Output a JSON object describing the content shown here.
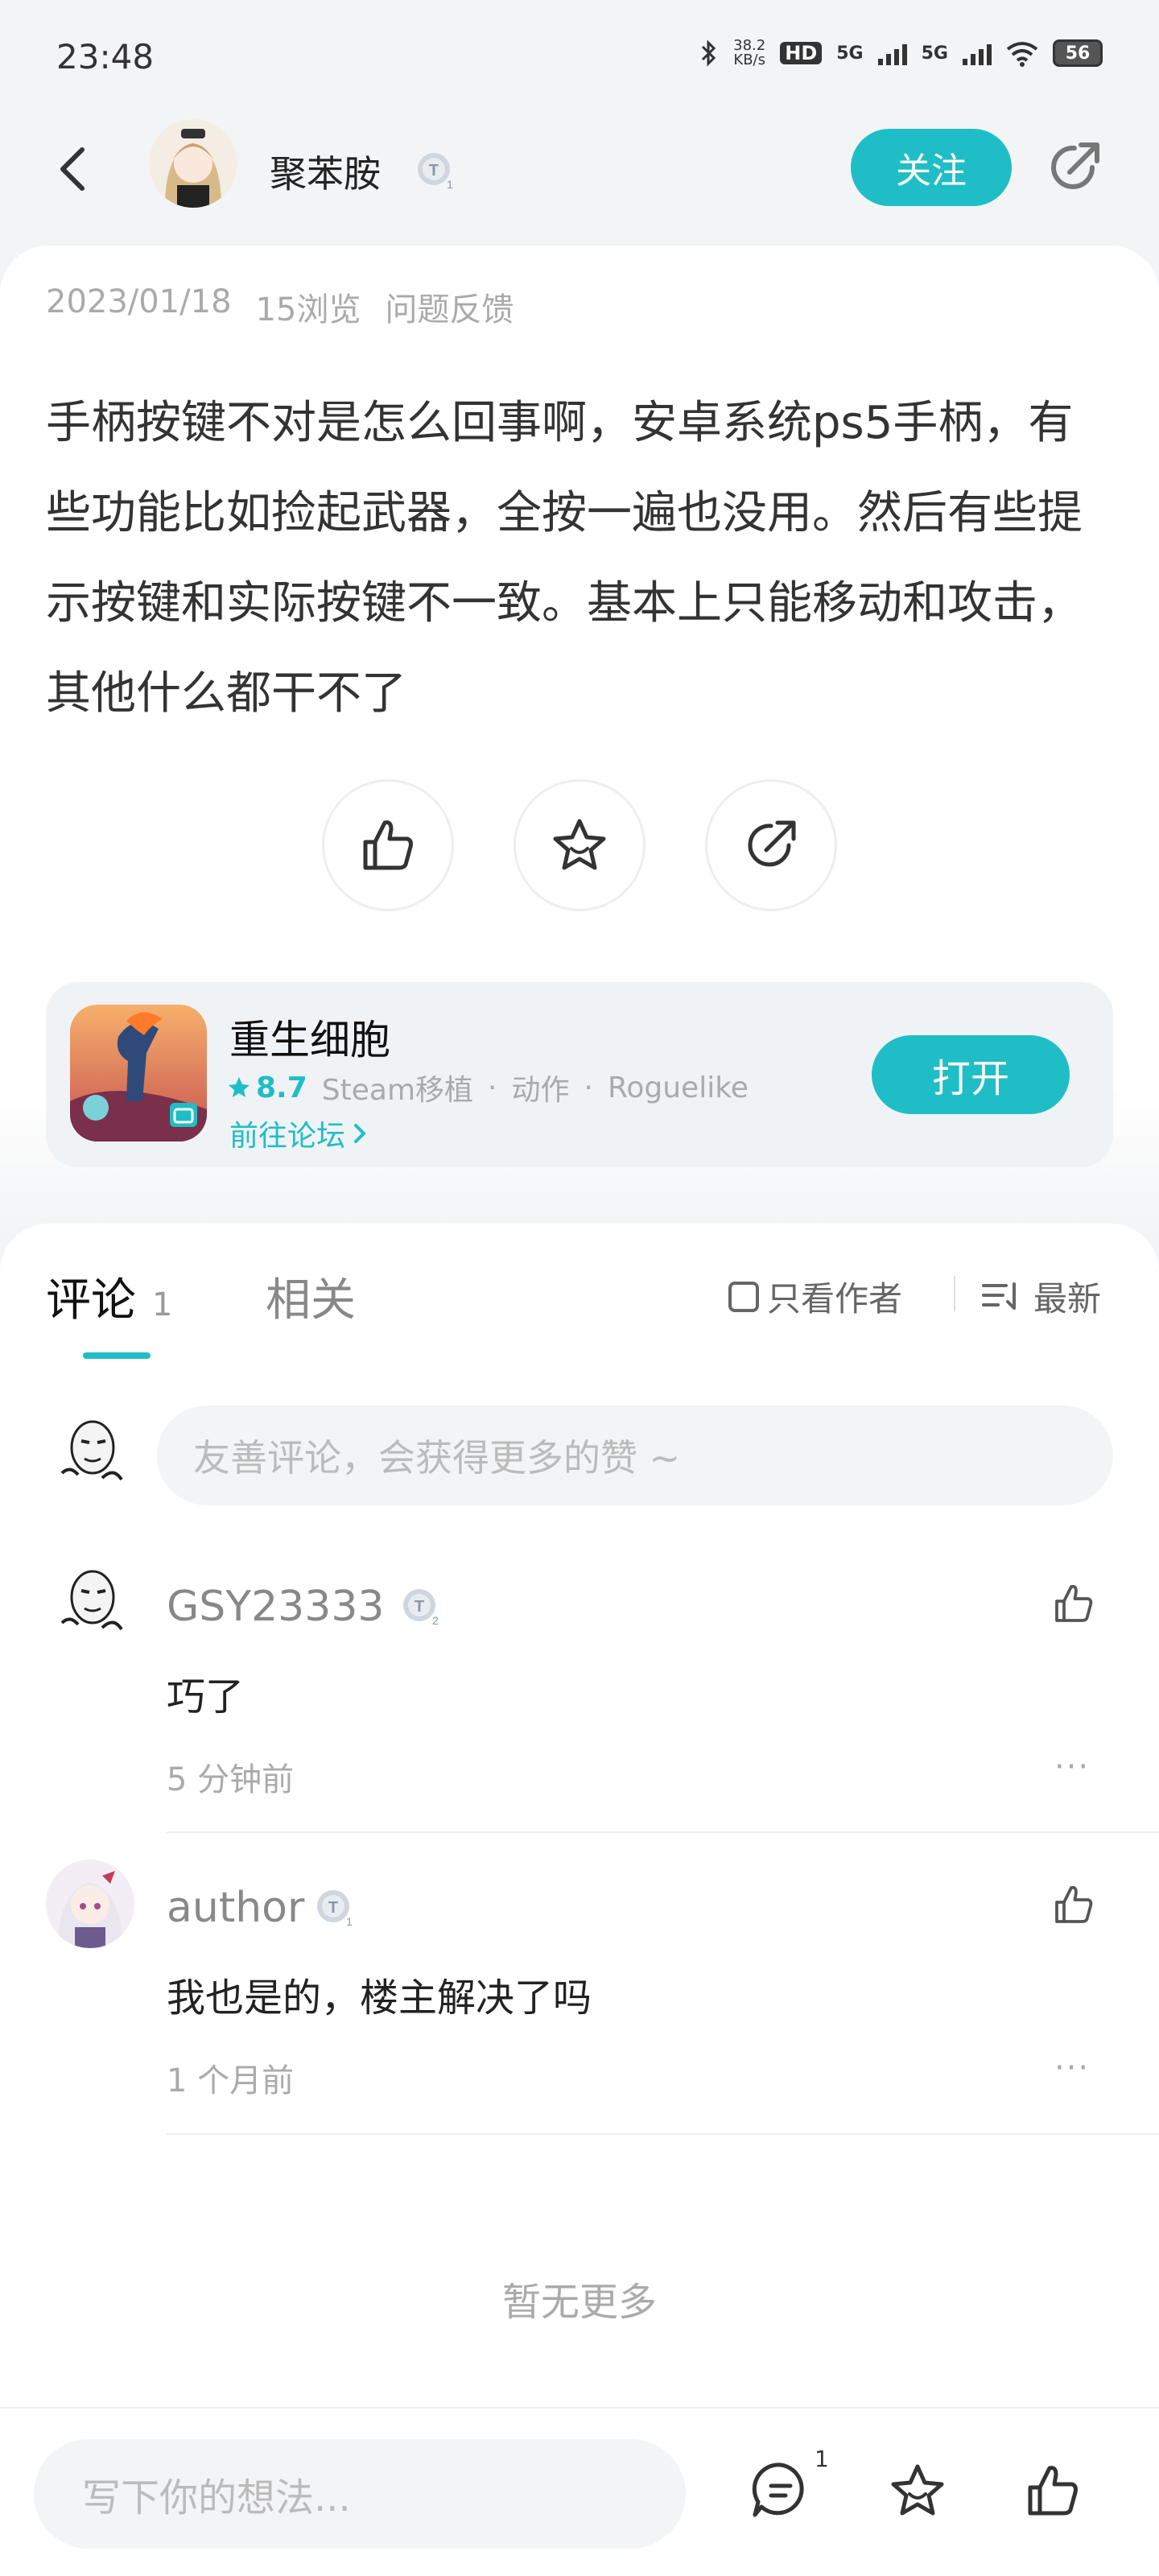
{
  "status_bar": {
    "time": "23:48",
    "net_speed_top": "38.2",
    "net_speed_unit": "KB/s",
    "hd_label": "HD",
    "sim1": "5G",
    "sim2": "5G",
    "battery": "56"
  },
  "header": {
    "author_name": "聚苯胺",
    "follow_label": "关注"
  },
  "post": {
    "date": "2023/01/18",
    "views": "15浏览",
    "category": "问题反馈",
    "body": "手柄按键不对是怎么回事啊，安卓系统ps5手柄，有些功能比如捡起武器，全按一遍也没用。然后有些提示按键和实际按键不一致。基本上只能移动和攻击，其他什么都干不了"
  },
  "game": {
    "title": "重生细胞",
    "rating": "8.7",
    "tag1": "Steam移植",
    "sep": "·",
    "tag2": "动作",
    "tag3": "Roguelike",
    "forum_link": "前往论坛",
    "open_label": "打开"
  },
  "comments_section": {
    "tab_comments": "评论",
    "tab_comments_count": "1",
    "tab_related": "相关",
    "author_only": "只看作者",
    "sort": "最新",
    "input_placeholder": "友善评论，会获得更多的赞 ~",
    "items": [
      {
        "name": "GSY23333",
        "text": "巧了",
        "time": "5 分钟前",
        "more": "···"
      },
      {
        "name": "author",
        "text": "我也是的，楼主解决了吗",
        "time": "1 个月前",
        "more": "···"
      }
    ],
    "no_more": "暂无更多"
  },
  "bottom_bar": {
    "placeholder": "写下你的想法...",
    "comment_count": "1"
  },
  "colors": {
    "accent": "#1fbec6",
    "background": "#f3f4f6"
  },
  "icons": [
    "back-icon",
    "share-icon",
    "thumbs-up-icon",
    "star-icon",
    "comment-icon",
    "sort-icon",
    "chevron-right-icon",
    "badge-icon"
  ]
}
